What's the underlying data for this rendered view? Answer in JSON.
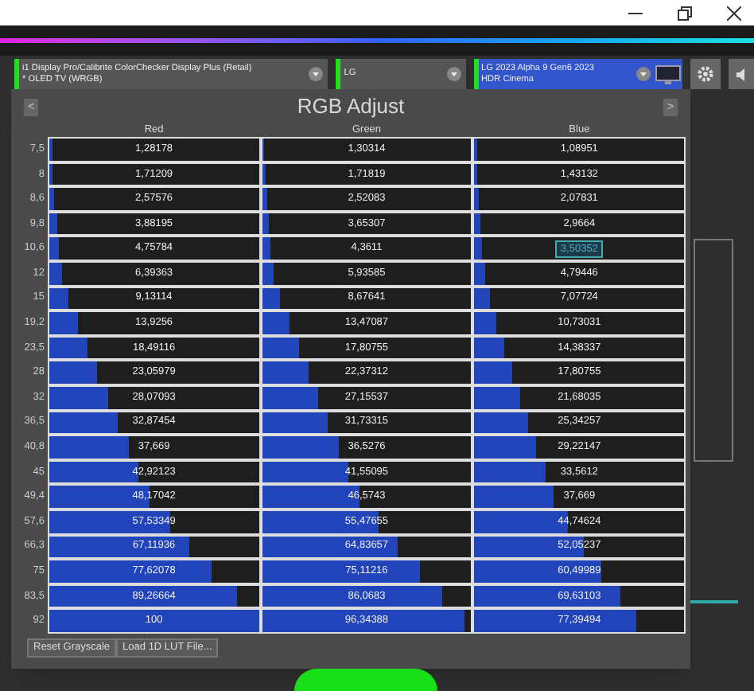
{
  "toolbar": {
    "meter": {
      "line1": "i1 Display Pro/Calibrite ColorChecker Display Plus (Retail)",
      "line2": "* OLED TV (WRGB)"
    },
    "brand": {
      "line1": "LG"
    },
    "display": {
      "line1": "LG 2023 Alpha 9 Gen6 2023",
      "line2": "HDR Cinema"
    }
  },
  "panel": {
    "title": "RGB Adjust",
    "prev": "<",
    "next": ">",
    "columns": [
      "Red",
      "Green",
      "Blue"
    ],
    "rows": [
      {
        "label": "7,5",
        "cells": [
          {
            "value": "1,28178",
            "level": 0.0128,
            "selected": false
          },
          {
            "value": "1,30314",
            "level": 0.013,
            "selected": false
          },
          {
            "value": "1,08951",
            "level": 0.0109,
            "selected": false
          }
        ]
      },
      {
        "label": "8",
        "cells": [
          {
            "value": "1,71209",
            "level": 0.0171,
            "selected": false
          },
          {
            "value": "1,71819",
            "level": 0.0172,
            "selected": false
          },
          {
            "value": "1,43132",
            "level": 0.0143,
            "selected": false
          }
        ]
      },
      {
        "label": "8,6",
        "cells": [
          {
            "value": "2,57576",
            "level": 0.0258,
            "selected": false
          },
          {
            "value": "2,52083",
            "level": 0.0252,
            "selected": false
          },
          {
            "value": "2,07831",
            "level": 0.0208,
            "selected": false
          }
        ]
      },
      {
        "label": "9,8",
        "cells": [
          {
            "value": "3,88195",
            "level": 0.0388,
            "selected": false
          },
          {
            "value": "3,65307",
            "level": 0.0365,
            "selected": false
          },
          {
            "value": "2,9664",
            "level": 0.0297,
            "selected": false
          }
        ]
      },
      {
        "label": "10,6",
        "cells": [
          {
            "value": "4,75784",
            "level": 0.0476,
            "selected": false
          },
          {
            "value": "4,3611",
            "level": 0.0436,
            "selected": false
          },
          {
            "value": "3,50352",
            "level": 0.035,
            "selected": true
          }
        ]
      },
      {
        "label": "12",
        "cells": [
          {
            "value": "6,39363",
            "level": 0.0639,
            "selected": false
          },
          {
            "value": "5,93585",
            "level": 0.0594,
            "selected": false
          },
          {
            "value": "4,79446",
            "level": 0.0479,
            "selected": false
          }
        ]
      },
      {
        "label": "15",
        "cells": [
          {
            "value": "9,13114",
            "level": 0.0913,
            "selected": false
          },
          {
            "value": "8,67641",
            "level": 0.0868,
            "selected": false
          },
          {
            "value": "7,07724",
            "level": 0.0708,
            "selected": false
          }
        ]
      },
      {
        "label": "19,2",
        "cells": [
          {
            "value": "13,9256",
            "level": 0.1393,
            "selected": false
          },
          {
            "value": "13,47087",
            "level": 0.1347,
            "selected": false
          },
          {
            "value": "10,73031",
            "level": 0.1073,
            "selected": false
          }
        ]
      },
      {
        "label": "23,5",
        "cells": [
          {
            "value": "18,49116",
            "level": 0.1849,
            "selected": false
          },
          {
            "value": "17,80755",
            "level": 0.1781,
            "selected": false
          },
          {
            "value": "14,38337",
            "level": 0.1438,
            "selected": false
          }
        ]
      },
      {
        "label": "28",
        "cells": [
          {
            "value": "23,05979",
            "level": 0.2306,
            "selected": false
          },
          {
            "value": "22,37312",
            "level": 0.2237,
            "selected": false
          },
          {
            "value": "17,80755",
            "level": 0.1781,
            "selected": false
          }
        ]
      },
      {
        "label": "32",
        "cells": [
          {
            "value": "28,07093",
            "level": 0.2807,
            "selected": false
          },
          {
            "value": "27,15537",
            "level": 0.2716,
            "selected": false
          },
          {
            "value": "21,68035",
            "level": 0.2168,
            "selected": false
          }
        ]
      },
      {
        "label": "36,5",
        "cells": [
          {
            "value": "32,87454",
            "level": 0.3287,
            "selected": false
          },
          {
            "value": "31,73315",
            "level": 0.3173,
            "selected": false
          },
          {
            "value": "25,34257",
            "level": 0.2534,
            "selected": false
          }
        ]
      },
      {
        "label": "40,8",
        "cells": [
          {
            "value": "37,669",
            "level": 0.3767,
            "selected": false
          },
          {
            "value": "36,5276",
            "level": 0.3653,
            "selected": false
          },
          {
            "value": "29,22147",
            "level": 0.2922,
            "selected": false
          }
        ]
      },
      {
        "label": "45",
        "cells": [
          {
            "value": "42,92123",
            "level": 0.4292,
            "selected": false
          },
          {
            "value": "41,55095",
            "level": 0.4155,
            "selected": false
          },
          {
            "value": "33,5612",
            "level": 0.3356,
            "selected": false
          }
        ]
      },
      {
        "label": "49,4",
        "cells": [
          {
            "value": "48,17042",
            "level": 0.4817,
            "selected": false
          },
          {
            "value": "46,5743",
            "level": 0.4657,
            "selected": false
          },
          {
            "value": "37,669",
            "level": 0.3767,
            "selected": false
          }
        ]
      },
      {
        "label": "57,6",
        "cells": [
          {
            "value": "57,53349",
            "level": 0.5753,
            "selected": false
          },
          {
            "value": "55,47655",
            "level": 0.5548,
            "selected": false
          },
          {
            "value": "44,74624",
            "level": 0.4475,
            "selected": false
          }
        ]
      },
      {
        "label": "66,3",
        "cells": [
          {
            "value": "67,11936",
            "level": 0.6712,
            "selected": false
          },
          {
            "value": "64,83657",
            "level": 0.6484,
            "selected": false
          },
          {
            "value": "52,05237",
            "level": 0.5205,
            "selected": false
          }
        ]
      },
      {
        "label": "75",
        "cells": [
          {
            "value": "77,62078",
            "level": 0.7762,
            "selected": false
          },
          {
            "value": "75,11216",
            "level": 0.7511,
            "selected": false
          },
          {
            "value": "60,49989",
            "level": 0.605,
            "selected": false
          }
        ]
      },
      {
        "label": "83,5",
        "cells": [
          {
            "value": "89,26664",
            "level": 0.8927,
            "selected": false
          },
          {
            "value": "86,0683",
            "level": 0.8607,
            "selected": false
          },
          {
            "value": "69,63103",
            "level": 0.6963,
            "selected": false
          }
        ]
      },
      {
        "label": "92",
        "cells": [
          {
            "value": "100",
            "level": 1,
            "selected": false
          },
          {
            "value": "96,34388",
            "level": 0.9634,
            "selected": false
          },
          {
            "value": "77,39494",
            "level": 0.7739,
            "selected": false
          }
        ]
      }
    ],
    "buttons": [
      "Reset Grayscale",
      "Load 1D LUT File..."
    ]
  }
}
